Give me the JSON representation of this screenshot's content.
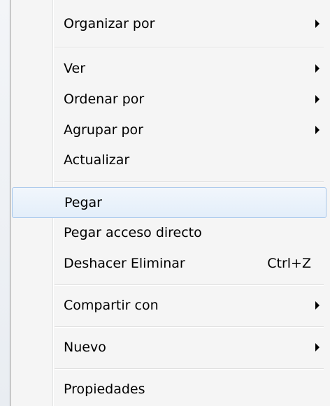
{
  "menu": {
    "items": [
      {
        "label": "Organizar por",
        "submenu": true
      },
      {
        "label": "Ver",
        "submenu": true
      },
      {
        "label": "Ordenar por",
        "submenu": true
      },
      {
        "label": "Agrupar por",
        "submenu": true
      },
      {
        "label": "Actualizar",
        "submenu": false
      },
      {
        "label": "Pegar",
        "submenu": false,
        "highlighted": true
      },
      {
        "label": "Pegar acceso directo",
        "submenu": false
      },
      {
        "label": "Deshacer Eliminar",
        "submenu": false,
        "shortcut": "Ctrl+Z"
      },
      {
        "label": "Compartir con",
        "submenu": true
      },
      {
        "label": "Nuevo",
        "submenu": true
      },
      {
        "label": "Propiedades",
        "submenu": false
      }
    ],
    "highlight_color": "#a8c8ec",
    "background_color": "#f5f5f5",
    "arrow_icon": "triangle-right-icon"
  }
}
